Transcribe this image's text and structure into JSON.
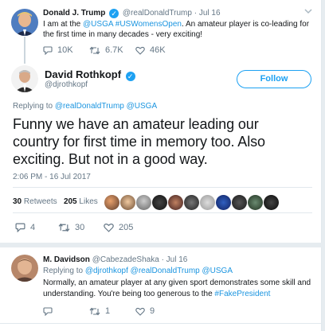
{
  "parent_tweet": {
    "name": "Donald J. Trump",
    "handle": "@realDonaldTrump",
    "date": "· Jul 16",
    "text_parts": [
      "I am at the ",
      "@USGA",
      " ",
      "#USWomensOpen",
      ". An amateur player is co-leading for"
    ],
    "text_line2": "the first time in many decades - very exciting!",
    "replies": "10K",
    "retweets": "6.7K",
    "likes": "46K"
  },
  "main_tweet": {
    "name": "David Rothkopf",
    "handle": "@djrothkopf",
    "follow_label": "Follow",
    "replying_prefix": "Replying to ",
    "replying_to": [
      "@realDonaldTrump",
      "@USGA"
    ],
    "text_lines": [
      "Funny we have an amateur leading our",
      "country for first time in memory too.  Also",
      "exciting.  But not in a good way."
    ],
    "timestamp": "2:06 PM - 16 Jul 2017",
    "retweet_count": "30",
    "retweet_label": "Retweets",
    "like_count": "205",
    "like_label": "Likes",
    "replies": "4",
    "retweets": "30",
    "likes": "205"
  },
  "reply_tweet": {
    "name": "M. Davidson",
    "handle": "@CabezadeShaka",
    "date": "· Jul 16",
    "replying_prefix": "Replying to ",
    "replying_to": [
      "@djrothkopf",
      "@realDonaldTrump",
      "@USGA"
    ],
    "text_line1": "Normally, an amateur player at any given sport demonstrates some skill and",
    "text_line2_prefix": "understanding. You're being too generous to the ",
    "text_line2_link": "#FakePresident",
    "replies": "",
    "retweets": "1",
    "likes": "9"
  },
  "colors": {
    "accent": "#1da1f2",
    "link": "#1b95e0",
    "muted": "#657786",
    "border": "#e1e8ed",
    "page_bg": "#e6ecf0"
  }
}
